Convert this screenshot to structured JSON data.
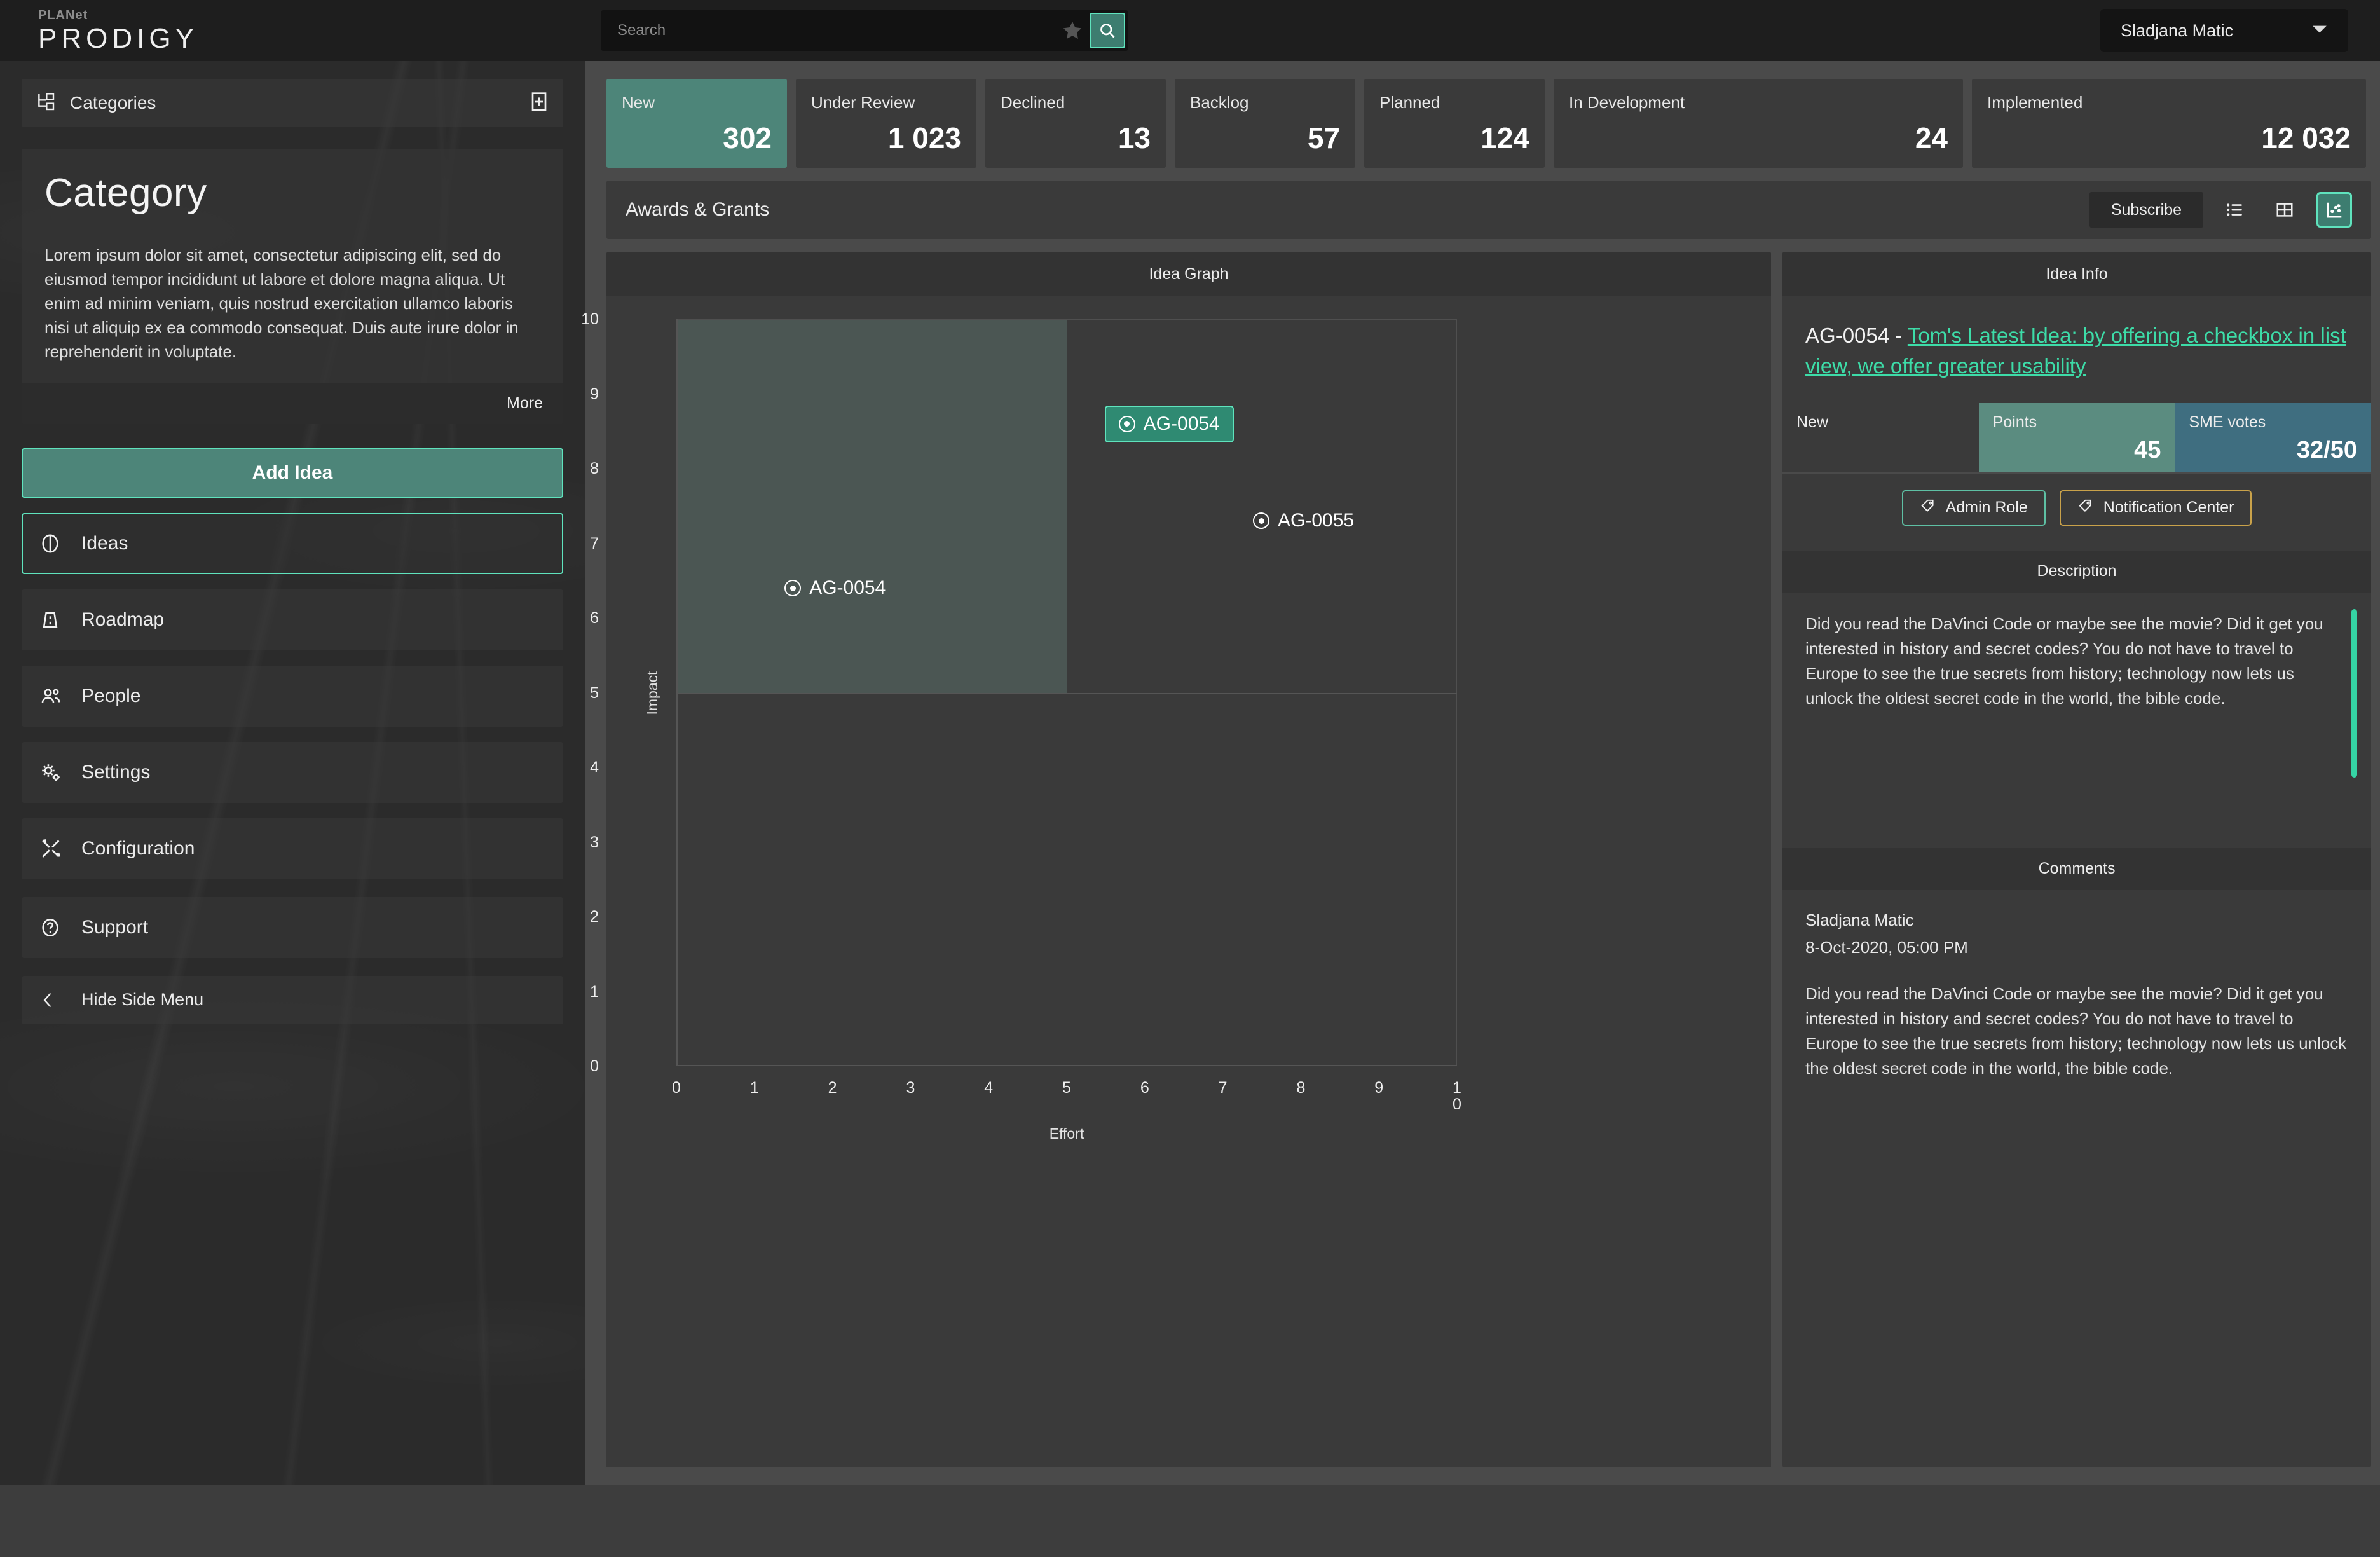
{
  "topbar": {
    "logo_top": "PLANet",
    "logo_main": "PRODIGY",
    "search_placeholder": "Search",
    "star_icon": "star-icon",
    "search_icon": "search-icon",
    "user_name": "Sladjana Matic",
    "user_caret": "chevron-down-icon"
  },
  "sidebar": {
    "categories_header": "Categories",
    "categories_icon": "sitemap-icon",
    "add_category_icon": "plus-box-icon",
    "category_card": {
      "title": "Category",
      "description": "Lorem ipsum dolor sit amet, consectetur adipiscing elit, sed do eiusmod tempor incididunt ut labore et dolore magna aliqua. Ut enim ad minim veniam, quis nostrud exercitation ullamco laboris nisi ut aliquip ex ea commodo consequat. Duis aute irure dolor in reprehenderit in voluptate.",
      "more_label": "More"
    },
    "add_idea_label": "Add Idea",
    "items": [
      {
        "label": "Ideas",
        "icon": "brain-icon",
        "active": true
      },
      {
        "label": "Roadmap",
        "icon": "road-icon",
        "active": false
      },
      {
        "label": "People",
        "icon": "people-icon",
        "active": false
      },
      {
        "label": "Settings",
        "icon": "gears-icon",
        "active": false
      },
      {
        "label": "Configuration",
        "icon": "tools-icon",
        "active": false
      }
    ],
    "support_label": "Support",
    "support_icon": "question-circle-icon",
    "hide_menu_label": "Hide Side Menu",
    "hide_menu_icon": "chevron-left-icon"
  },
  "status_cards": [
    {
      "title": "New",
      "count": "302",
      "active": true
    },
    {
      "title": "Under Review",
      "count": "1 023",
      "active": false
    },
    {
      "title": "Declined",
      "count": "13",
      "active": false
    },
    {
      "title": "Backlog",
      "count": "57",
      "active": false
    },
    {
      "title": "Planned",
      "count": "124",
      "active": false
    },
    {
      "title": "In Development",
      "count": "24",
      "active": false
    },
    {
      "title": "Implemented",
      "count": "12 032",
      "active": false
    }
  ],
  "toolbar": {
    "title": "Awards & Grants",
    "subscribe_label": "Subscribe",
    "view_list_icon": "list-view-icon",
    "view_grid_icon": "grid-view-icon",
    "view_chart_icon": "scatter-chart-icon",
    "active_view": "chart"
  },
  "graph_panel": {
    "title": "Idea Graph"
  },
  "chart_data": {
    "type": "scatter",
    "title": "Idea Graph",
    "xlabel": "Effort",
    "ylabel": "Impact",
    "xlim": [
      0,
      10
    ],
    "ylim": [
      0,
      10
    ],
    "xticks": [
      "0",
      "1",
      "2",
      "3",
      "4",
      "5",
      "6",
      "7",
      "8",
      "9",
      "10"
    ],
    "yticks": [
      "0",
      "1",
      "2",
      "3",
      "4",
      "5",
      "6",
      "7",
      "8",
      "9",
      "10"
    ],
    "grid": true,
    "highlight_quadrant": {
      "x": [
        0,
        5
      ],
      "y": [
        5,
        10
      ],
      "color": "#4b5653"
    },
    "points": [
      {
        "label": "AG-0054",
        "x": 1.5,
        "y": 6.4,
        "selected": false
      },
      {
        "label": "AG-0054",
        "x": 5.6,
        "y": 8.6,
        "selected": true
      },
      {
        "label": "AG-0055",
        "x": 7.5,
        "y": 7.3,
        "selected": false
      }
    ]
  },
  "info_panel": {
    "title": "Idea Info",
    "idea_code": "AG-0054 - ",
    "idea_title": "Tom's Latest Idea: by offering a checkbox in list view, we offer greater usability",
    "metrics": [
      {
        "label": "New",
        "value": ""
      },
      {
        "label": "Points",
        "value": "45"
      },
      {
        "label": "SME votes",
        "value": "32/50"
      }
    ],
    "tags": [
      {
        "label": "Admin Role",
        "color": "#5ec0a4",
        "icon": "tag-icon"
      },
      {
        "label": "Notification Center",
        "color": "#c9a24a",
        "icon": "tag-icon"
      }
    ],
    "description_title": "Description",
    "description_text": "Did you read the DaVinci Code or maybe see the movie? Did it get you interested in history and secret codes? You do not have to travel to Europe to see the true secrets from history; technology now lets us unlock the oldest secret code in the world, the bible code.",
    "comments_title": "Comments",
    "comment": {
      "author": "Sladjana Matic",
      "date": "8-Oct-2020, 05:00 PM",
      "text": "Did you read the DaVinci Code or maybe see the movie? Did it get you interested in history and secret codes? You do not have to travel to Europe to see the true secrets from history; technology now lets us unlock the oldest secret code in the world, the bible code."
    }
  },
  "colors": {
    "accent_teal": "#5fe3bd",
    "accent_teal_dark": "#4d8579",
    "link_teal": "#3ddca8",
    "gold": "#c9a24a",
    "blue": "#3f6e80"
  }
}
